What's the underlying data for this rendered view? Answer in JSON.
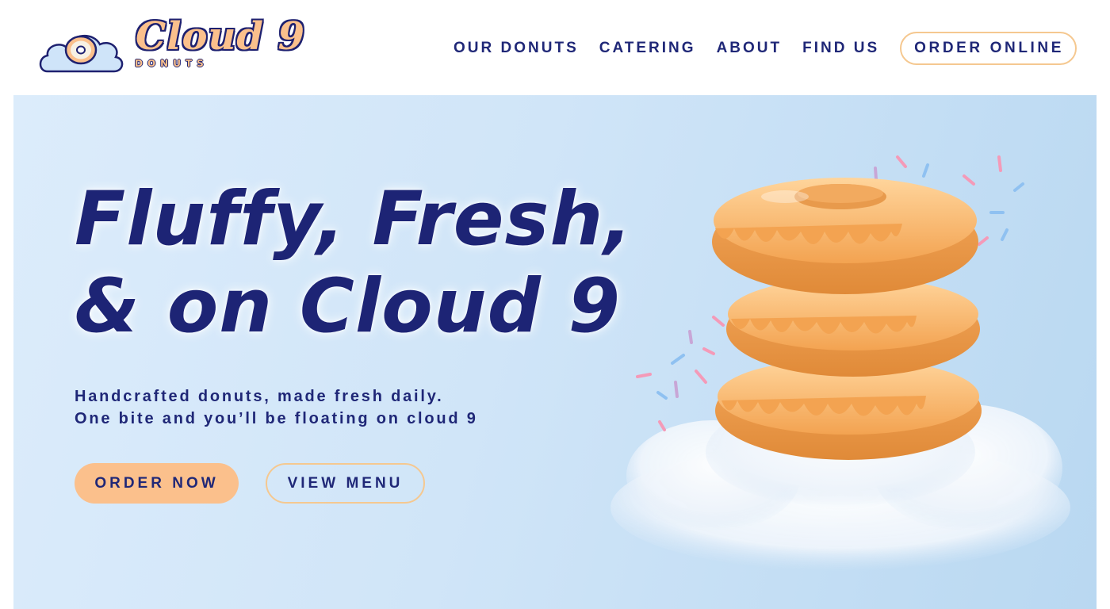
{
  "brand": {
    "name": "Cloud 9",
    "sub": "DONUTS",
    "colors": {
      "navy": "#1f2777",
      "peach": "#fbc08c",
      "sky": "#d0e5f8"
    }
  },
  "nav": {
    "items": [
      {
        "label": "OUR DONUTS"
      },
      {
        "label": "CATERING"
      },
      {
        "label": "ABOUT"
      },
      {
        "label": "FIND US"
      }
    ],
    "cta": "ORDER ONLINE"
  },
  "hero": {
    "headline_line1": "Fluffy, Fresh,",
    "headline_line2": "& on Cloud 9",
    "sub_line1": "Handcrafted donuts, made fresh daily.",
    "sub_line2": "One bite and you’ll be floating on cloud 9",
    "primary_button": "ORDER NOW",
    "secondary_button": "VIEW MENU",
    "image": "stacked-glazed-donuts-on-cloud"
  }
}
